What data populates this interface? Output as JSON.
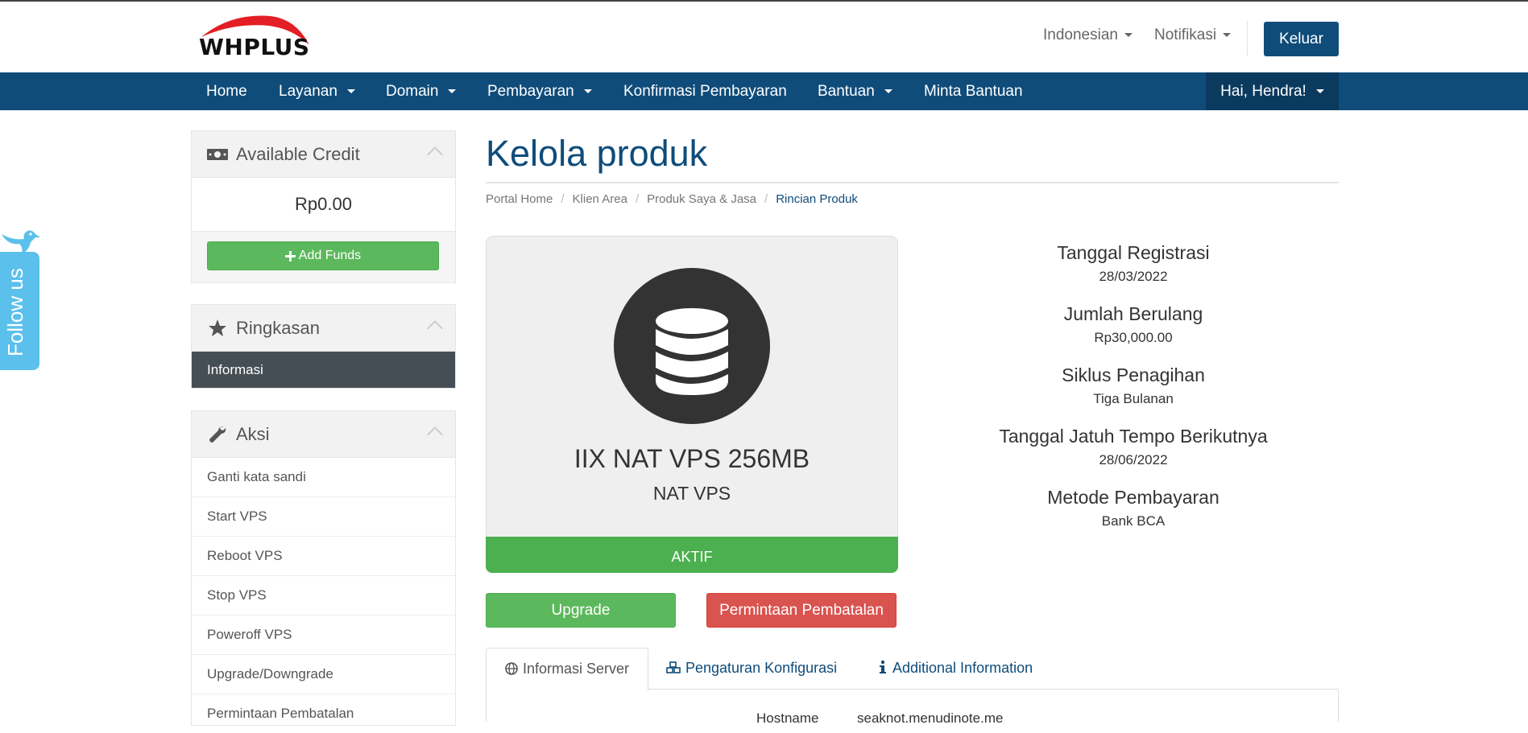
{
  "brand": {
    "logo_text": "WHPLUS",
    "accent": "#0f4c7a",
    "logo_swoosh": "#e31e24"
  },
  "header": {
    "language": "Indonesian",
    "notifications": "Notifikasi",
    "logout": "Keluar"
  },
  "nav": {
    "items": [
      {
        "label": "Home",
        "dropdown": false
      },
      {
        "label": "Layanan",
        "dropdown": true
      },
      {
        "label": "Domain",
        "dropdown": true
      },
      {
        "label": "Pembayaran",
        "dropdown": true
      },
      {
        "label": "Konfirmasi Pembayaran",
        "dropdown": false
      },
      {
        "label": "Bantuan",
        "dropdown": true
      },
      {
        "label": "Minta Bantuan",
        "dropdown": false
      }
    ],
    "user": "Hai, Hendra!"
  },
  "follow": {
    "label": "Follow us",
    "icon": "twitter-bird-icon"
  },
  "sidebar": {
    "credit": {
      "title": "Available Credit",
      "icon": "money-icon",
      "amount": "Rp0.00",
      "add_funds": "Add Funds"
    },
    "summary": {
      "title": "Ringkasan",
      "icon": "star-icon",
      "active_item": "Informasi"
    },
    "actions": {
      "title": "Aksi",
      "icon": "wrench-icon",
      "items": [
        "Ganti kata sandi",
        "Start VPS",
        "Reboot VPS",
        "Stop VPS",
        "Poweroff VPS",
        "Upgrade/Downgrade",
        "Permintaan Pembatalan"
      ]
    }
  },
  "main": {
    "title": "Kelola produk",
    "breadcrumb": [
      "Portal Home",
      "Klien Area",
      "Produk Saya & Jasa",
      "Rincian Produk"
    ],
    "product": {
      "icon": "database-icon",
      "name": "IIX NAT VPS 256MB",
      "group": "NAT VPS",
      "status": "AKTIF",
      "status_color": "#4caf50"
    },
    "buttons": {
      "upgrade": "Upgrade",
      "cancel": "Permintaan Pembatalan"
    },
    "info": [
      {
        "label": "Tanggal Registrasi",
        "value": "28/03/2022"
      },
      {
        "label": "Jumlah Berulang",
        "value": "Rp30,000.00"
      },
      {
        "label": "Siklus Penagihan",
        "value": "Tiga Bulanan"
      },
      {
        "label": "Tanggal Jatuh Tempo Berikutnya",
        "value": "28/06/2022"
      },
      {
        "label": "Metode Pembayaran",
        "value": "Bank BCA"
      }
    ],
    "tabs": [
      {
        "label": "Informasi Server",
        "icon": "globe-icon",
        "active": true
      },
      {
        "label": "Pengaturan Konfigurasi",
        "icon": "cubes-icon",
        "active": false
      },
      {
        "label": "Additional Information",
        "icon": "info-icon",
        "active": false
      }
    ],
    "server_row": {
      "label": "Hostname",
      "value": "seaknot.menudinote.me"
    }
  }
}
